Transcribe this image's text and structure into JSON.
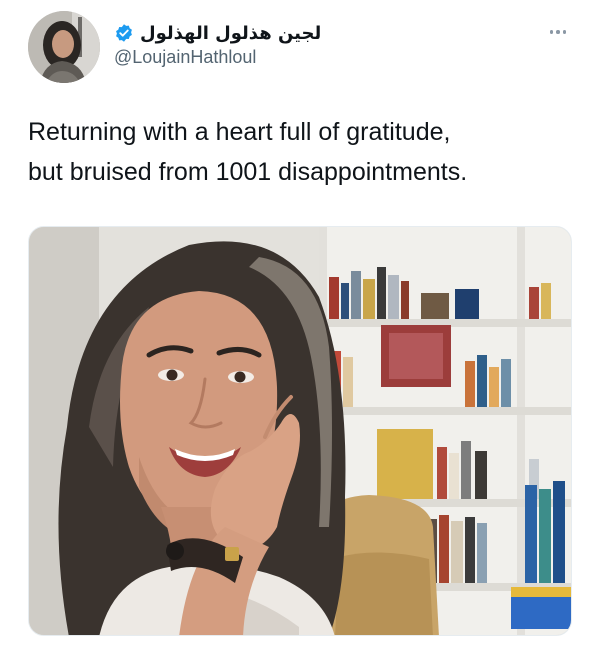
{
  "author": {
    "display_name": "لجين هذلول الهذلول",
    "handle": "@LoujainHathloul",
    "verified": true,
    "avatar_icon": "profile-photo"
  },
  "tweet": {
    "text_line1": "Returning with a heart full of gratitude,",
    "text_line2": "but bruised from 1001 disappointments."
  },
  "media": {
    "type": "photo",
    "description": "selfie-photo"
  },
  "colors": {
    "verified": "#1d9bf0",
    "text_primary": "#0f1419",
    "text_secondary": "#536471"
  },
  "icons": {
    "more": "more-dots-icon",
    "verified": "verified-badge-icon"
  }
}
